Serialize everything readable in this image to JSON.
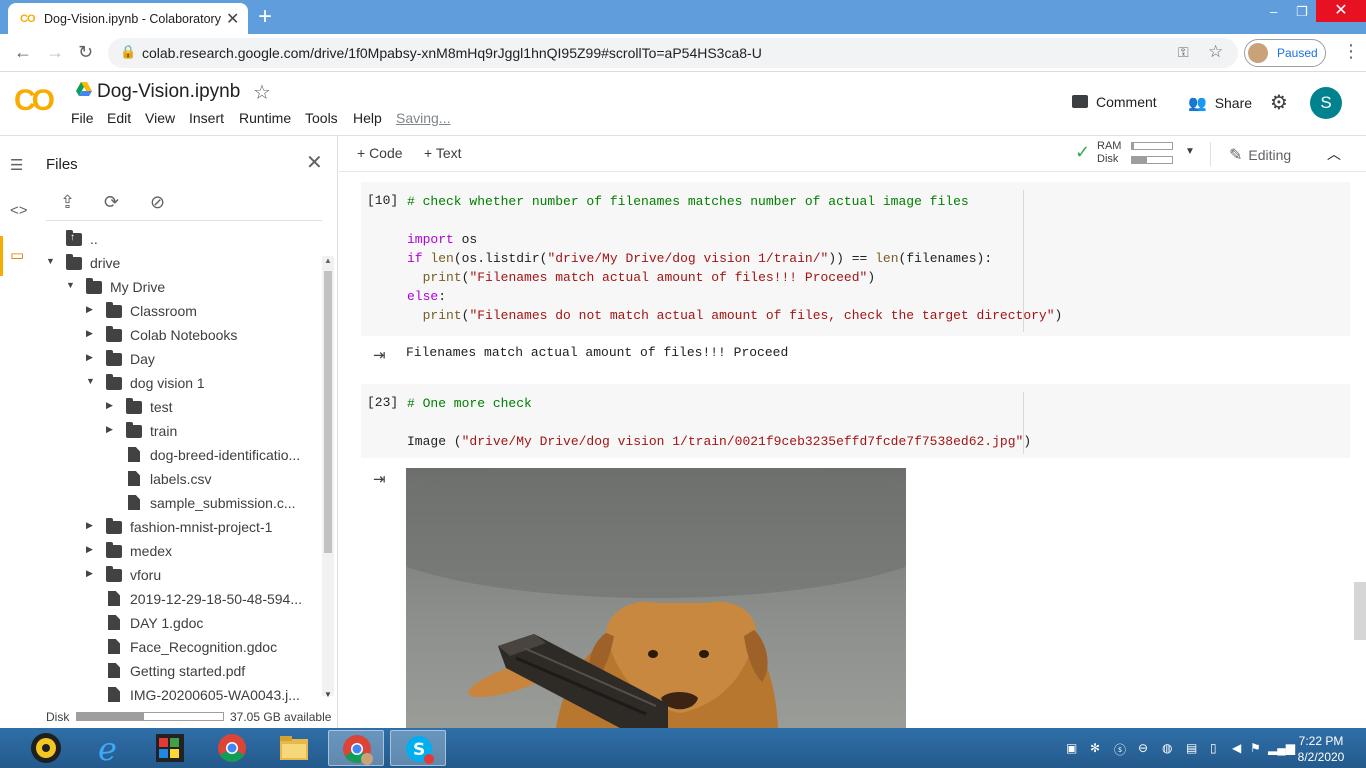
{
  "browser": {
    "tab_title": "Dog-Vision.ipynb - Colaboratory",
    "url": "colab.research.google.com/drive/1f0Mpabsy-xnM8mHq9rJggl1hnQI95Z99#scrollTo=aP54HS3ca8-U",
    "profile_status": "Paused"
  },
  "colab": {
    "logo_text": "CO",
    "notebook_title": "Dog-Vision.ipynb",
    "menu": [
      "File",
      "Edit",
      "View",
      "Insert",
      "Runtime",
      "Tools",
      "Help"
    ],
    "saving": "Saving...",
    "comment_label": "Comment",
    "share_label": "Share",
    "avatar_letter": "S"
  },
  "sidebar": {
    "title": "Files",
    "tree": [
      {
        "label": "..",
        "type": "up",
        "depth": 0,
        "arrow": ""
      },
      {
        "label": "drive",
        "type": "folder",
        "depth": 0,
        "arrow": "open"
      },
      {
        "label": "My Drive",
        "type": "folder",
        "depth": 1,
        "arrow": "open"
      },
      {
        "label": "Classroom",
        "type": "folder",
        "depth": 2,
        "arrow": "closed"
      },
      {
        "label": "Colab Notebooks",
        "type": "folder",
        "depth": 2,
        "arrow": "closed"
      },
      {
        "label": "Day",
        "type": "folder",
        "depth": 2,
        "arrow": "closed"
      },
      {
        "label": "dog vision 1",
        "type": "folder",
        "depth": 2,
        "arrow": "open"
      },
      {
        "label": "test",
        "type": "folder",
        "depth": 3,
        "arrow": "closed"
      },
      {
        "label": "train",
        "type": "folder",
        "depth": 3,
        "arrow": "closed"
      },
      {
        "label": "dog-breed-identificatio...",
        "type": "file",
        "depth": 3,
        "arrow": ""
      },
      {
        "label": "labels.csv",
        "type": "file",
        "depth": 3,
        "arrow": ""
      },
      {
        "label": "sample_submission.c...",
        "type": "file",
        "depth": 3,
        "arrow": ""
      },
      {
        "label": "fashion-mnist-project-1",
        "type": "folder",
        "depth": 2,
        "arrow": "closed"
      },
      {
        "label": "medex",
        "type": "folder",
        "depth": 2,
        "arrow": "closed"
      },
      {
        "label": "vforu",
        "type": "folder",
        "depth": 2,
        "arrow": "closed"
      },
      {
        "label": "2019-12-29-18-50-48-594...",
        "type": "file",
        "depth": 2,
        "arrow": ""
      },
      {
        "label": "DAY 1.gdoc",
        "type": "file",
        "depth": 2,
        "arrow": ""
      },
      {
        "label": "Face_Recognition.gdoc",
        "type": "file",
        "depth": 2,
        "arrow": ""
      },
      {
        "label": "Getting started.pdf",
        "type": "file",
        "depth": 2,
        "arrow": ""
      },
      {
        "label": "IMG-20200605-WA0043.j...",
        "type": "file",
        "depth": 2,
        "arrow": ""
      }
    ],
    "disk_label": "Disk",
    "disk_fraction": 0.46,
    "disk_available": "37.05 GB available"
  },
  "toolbar": {
    "code_label": "+ Code",
    "text_label": "+ Text",
    "ram_label": "RAM",
    "disk_label": "Disk",
    "ram_fraction": 0.06,
    "disk_fraction": 0.38,
    "editing_label": "Editing"
  },
  "cells": {
    "cell1": {
      "exec_count": "[10]",
      "lines": [
        "# check whether number of filenames matches number of actual image files",
        "",
        "import os",
        "if len(os.listdir(\"drive/My Drive/dog vision 1/train/\")) == len(filenames):",
        "  print(\"Filenames match actual amount of files!!! Proceed\")",
        "else:",
        "  print(\"Filenames do not match actual amount of files, check the target directory\")"
      ],
      "output": "Filenames match actual amount of files!!! Proceed"
    },
    "cell2": {
      "exec_count": "[23]",
      "lines": [
        "# One more check",
        "",
        "Image (\"drive/My Drive/dog vision 1/train/0021f9ceb3235effd7fcde7f7538ed62.jpg\")"
      ]
    }
  },
  "taskbar": {
    "time": "7:22 PM",
    "date": "8/2/2020"
  }
}
